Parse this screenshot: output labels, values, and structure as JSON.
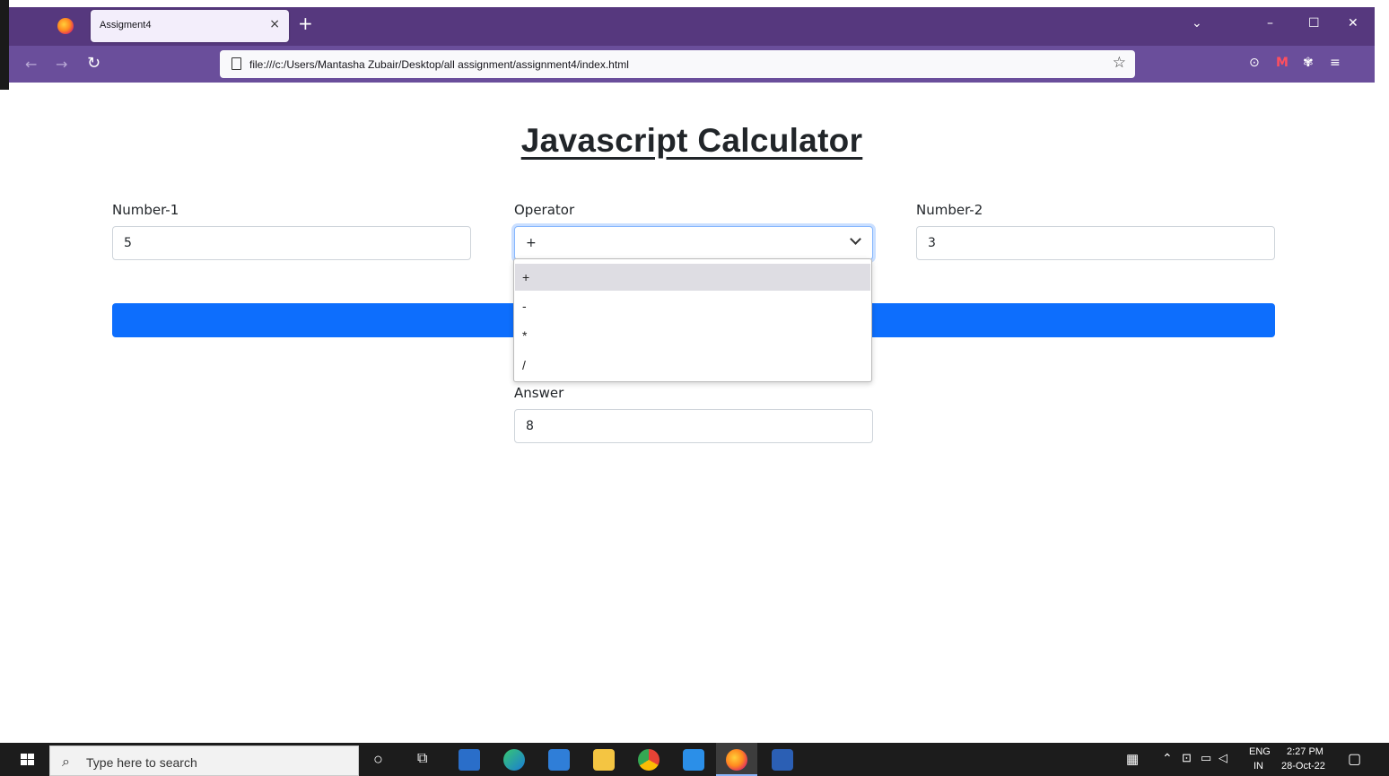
{
  "browser": {
    "tab_title": "Assigment4",
    "tab_close": "×",
    "new_tab": "+",
    "url": "file:///c:/Users/Mantasha Zubair/Desktop/all assignment/assignment4/index.html",
    "window_controls": {
      "list": "⌄",
      "minimize": "–",
      "maximize": "☐",
      "close": "✕"
    }
  },
  "page": {
    "title": "Javascript Calculator",
    "number1": {
      "label": "Number-1",
      "value": "5"
    },
    "operator": {
      "label": "Operator",
      "value": "+",
      "options": [
        "+",
        "-",
        "*",
        "/"
      ],
      "selected_index": 0
    },
    "number2": {
      "label": "Number-2",
      "value": "3"
    },
    "answer": {
      "label": "Answer",
      "value": "8"
    },
    "button_color": "#0d6efd"
  },
  "taskbar": {
    "search_placeholder": "Type here to search",
    "language": "ENG",
    "region": "IN",
    "time": "2:27 PM",
    "date": "28-Oct-22"
  },
  "colors": {
    "tabbar": "#56387e",
    "navbar": "#6a4e9b",
    "primary": "#0d6efd"
  }
}
